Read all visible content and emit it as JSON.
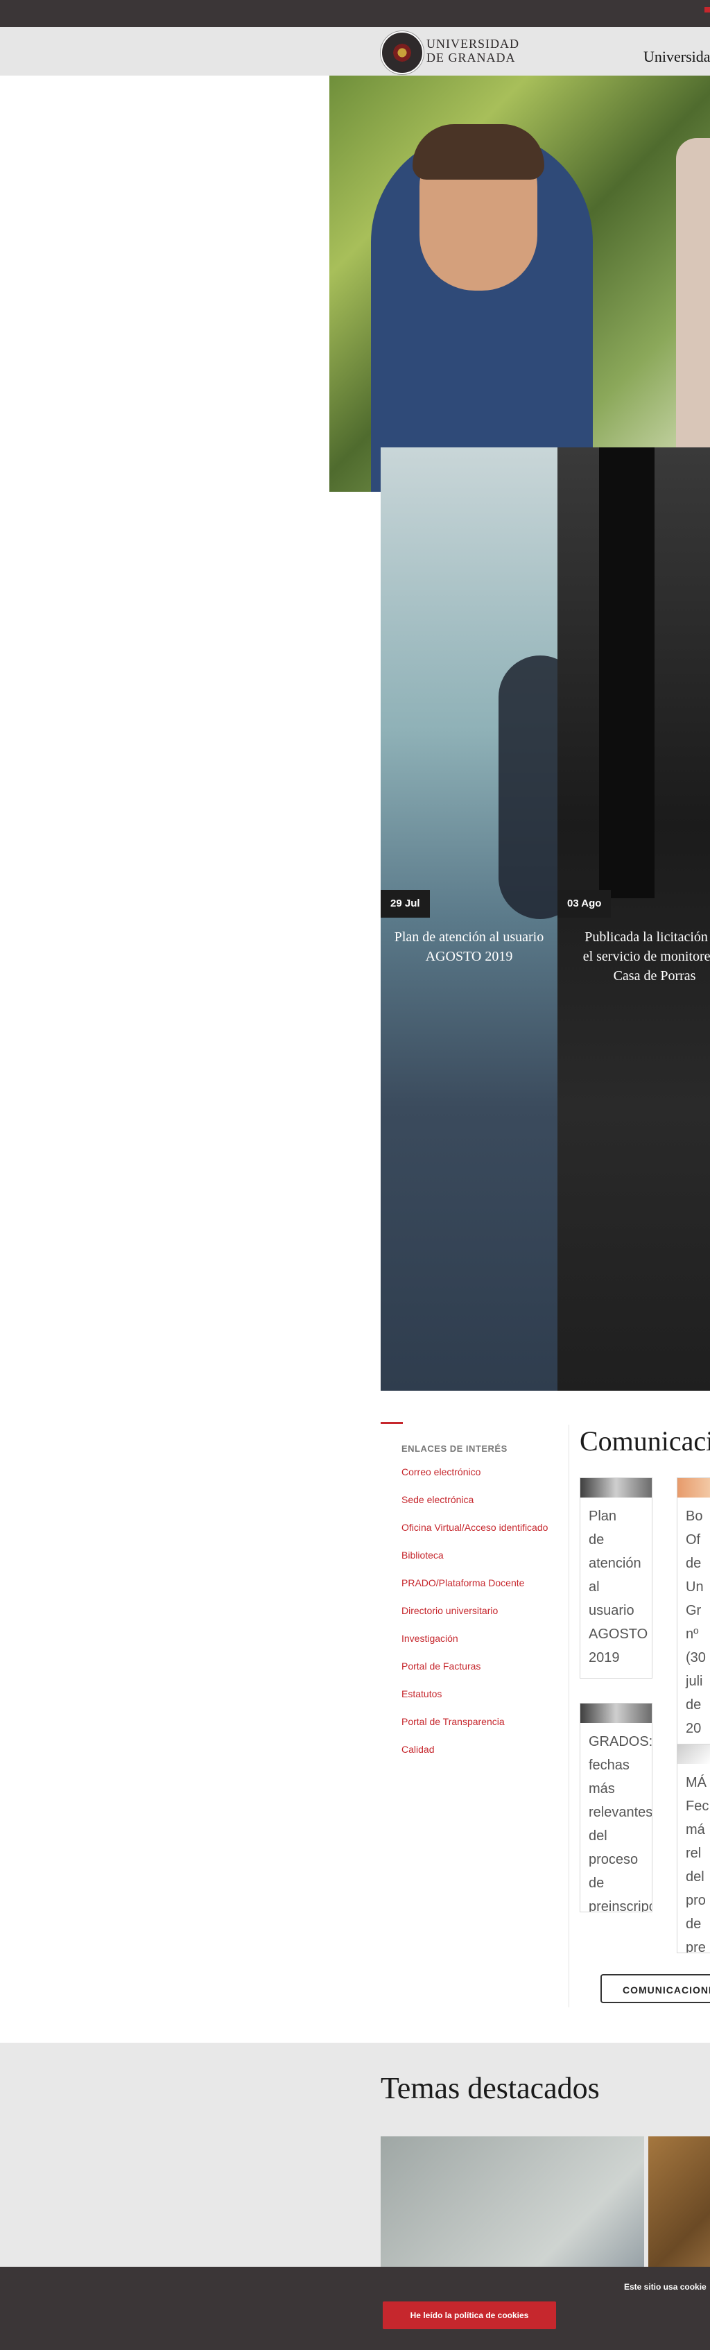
{
  "header": {
    "logo_line1": "UNIVERSIDAD",
    "logo_line2": "DE GRANADA",
    "nav_partial": "Universidad"
  },
  "news": [
    {
      "date": "29 Jul",
      "title": "Plan de atención al usuario AGOSTO 2019"
    },
    {
      "date": "03 Ago",
      "title_lines": [
        "Publicada la licitación pa",
        "el servicio de monitores d",
        "Casa de Porras"
      ]
    }
  ],
  "links": {
    "heading": "ENLACES DE INTERÉS",
    "items": [
      "Correo electrónico",
      "Sede electrónica",
      "Oficina Virtual/Acceso identificado",
      "Biblioteca",
      "PRADO/Plataforma Docente",
      "Directorio universitario",
      "Investigación",
      "Portal de Facturas",
      "Estatutos",
      "Portal de Transparencia",
      "Calidad"
    ]
  },
  "comunicaciones": {
    "title": "Comunicacion",
    "cards": [
      {
        "lines": [
          "Plan",
          "de",
          "atención",
          "al",
          "usuario",
          "AGOSTO",
          "2019"
        ]
      },
      {
        "lines": [
          "GRADOS:",
          "fechas",
          "más",
          "relevantes",
          "del",
          "proceso",
          "de",
          "preinscripción"
        ]
      },
      {
        "lines": [
          "Bo",
          "Of",
          "de",
          "Un",
          "Gr",
          "nº",
          "(30",
          "juli",
          "de",
          "20"
        ]
      },
      {
        "lines": [
          "MÁ",
          "Fec",
          "má",
          "rel",
          "del",
          "pro",
          "de",
          "pre"
        ]
      }
    ],
    "button_label": "COMUNICACIONE"
  },
  "temas": {
    "title": "Temas destacados"
  },
  "cookies": {
    "text": "Este sitio usa cookie",
    "button_label": "He leído la política de cookies"
  },
  "colors": {
    "accent": "#c6272d",
    "dark_bar": "#3b3637",
    "header_bg": "#e6e6e6"
  }
}
